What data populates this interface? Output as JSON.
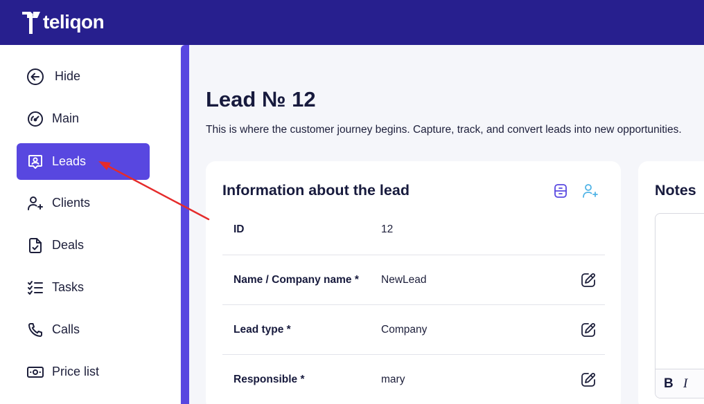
{
  "app": {
    "logo_text": "teliqon",
    "colors": {
      "topbar": "#271f8e",
      "accent": "#5847e0",
      "annotation_arrow": "#e52b2b"
    }
  },
  "sidebar": {
    "hide_label": "Hide",
    "items": [
      {
        "label": "Main",
        "icon": "gauge-icon"
      },
      {
        "label": "Leads",
        "icon": "lead-badge-icon",
        "active": true
      },
      {
        "label": "Clients",
        "icon": "user-plus-icon"
      },
      {
        "label": "Deals",
        "icon": "document-check-icon"
      },
      {
        "label": "Tasks",
        "icon": "checklist-icon"
      },
      {
        "label": "Calls",
        "icon": "phone-icon"
      },
      {
        "label": "Price list",
        "icon": "cash-icon"
      }
    ]
  },
  "page": {
    "title": "Lead № 12",
    "subtitle": "This is where the customer journey begins. Capture, track, and convert leads into new opportunities."
  },
  "lead_card": {
    "title": "Information about the lead",
    "actions": [
      "archive-icon",
      "convert-to-client-icon"
    ],
    "rows": [
      {
        "label": "ID",
        "value": "12"
      },
      {
        "label": "Name / Company name *",
        "value": "NewLead"
      },
      {
        "label": "Lead type *",
        "value": "Company"
      },
      {
        "label": "Responsible *",
        "value": "mary"
      }
    ]
  },
  "notes_card": {
    "title": "Notes",
    "toolbar": {
      "bold": "B",
      "italic": "I"
    }
  }
}
